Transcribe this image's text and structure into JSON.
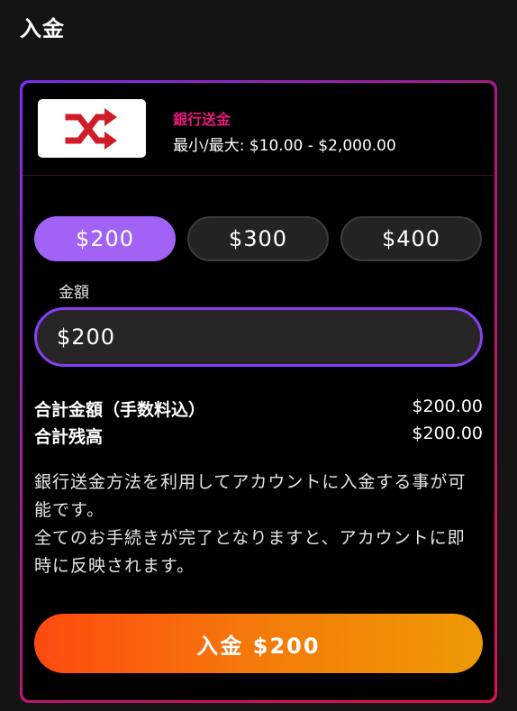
{
  "page": {
    "title": "入金"
  },
  "method": {
    "name": "銀行送金",
    "limits": "最小/最大: $10.00 - $2,000.00",
    "icon": "shuffle-icon",
    "icon_color": "#d01c27",
    "accent": "#e8177d"
  },
  "chips": [
    {
      "label": "$200",
      "selected": true
    },
    {
      "label": "$300",
      "selected": false
    },
    {
      "label": "$400",
      "selected": false
    }
  ],
  "amount": {
    "label": "金額",
    "value": "$200"
  },
  "summary": {
    "total_label": "合計金額（手数料込）",
    "total_value": "$200.00",
    "balance_label": "合計残高",
    "balance_value": "$200.00"
  },
  "description": {
    "line1": "銀行送金方法を利用してアカウントに入金する事が可能です。",
    "line2": "全てのお手続きが完了となりますと、アカウントに即時に反映されます。"
  },
  "submit": {
    "label": "入金 $200"
  },
  "colors": {
    "chip_selected": "#a262f5",
    "input_border": "#8a3ff2",
    "button_gradient_start": "#ff4a10",
    "button_gradient_end": "#ee9a05"
  }
}
